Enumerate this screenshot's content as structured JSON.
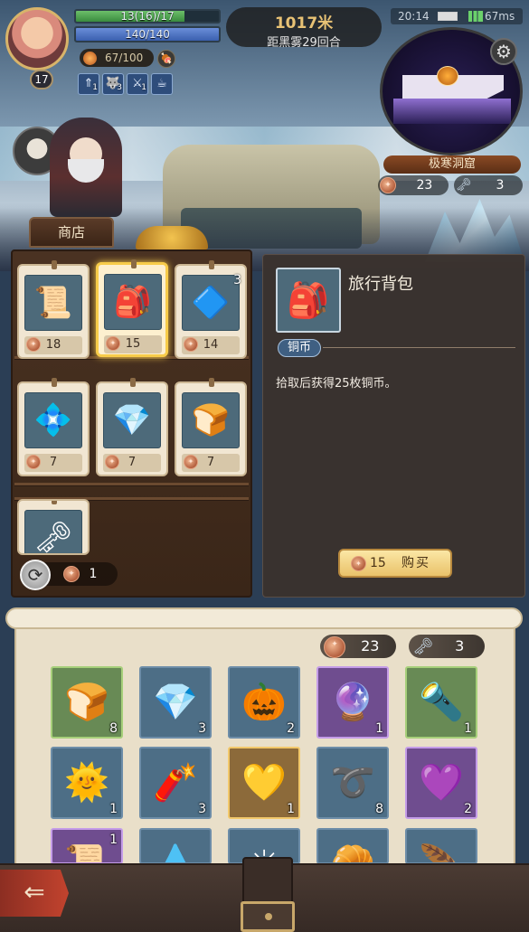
{
  "hud": {
    "hp_text": "13(16)/17",
    "hp_fraction": 0.76,
    "mp_text": "140/140",
    "mp_fraction": 1.0,
    "food_text": "67/100",
    "level": "17",
    "buffs": [
      {
        "icon": "attack-up-icon",
        "count": "1"
      },
      {
        "icon": "wolf-icon",
        "count": "3"
      },
      {
        "icon": "sword-icon",
        "count": "1"
      },
      {
        "icon": "potion-icon",
        "count": ""
      }
    ]
  },
  "depth": {
    "distance": "1017米",
    "subtitle": "距黑雾29回合"
  },
  "status": {
    "time": "20:14",
    "ping": "67ms"
  },
  "region": {
    "name": "极寒洞窟",
    "coins": "23",
    "keys": "3"
  },
  "shop": {
    "tab_label": "商店",
    "refresh_cost": "1",
    "items": [
      {
        "icon": "scroll-icon",
        "glyph": "📜",
        "price": "18",
        "qty": "",
        "selected": false
      },
      {
        "icon": "backpack-icon",
        "glyph": "🎒",
        "price": "15",
        "qty": "",
        "selected": true
      },
      {
        "icon": "magic-scroll-icon",
        "glyph": "🔷",
        "price": "14",
        "qty": "3",
        "selected": false
      },
      {
        "icon": "crystal-shard-icon",
        "glyph": "💠",
        "price": "7",
        "qty": "",
        "selected": false
      },
      {
        "icon": "blue-crystal-icon",
        "glyph": "💎",
        "price": "7",
        "qty": "",
        "selected": false
      },
      {
        "icon": "bread-icon",
        "glyph": "🍞",
        "price": "7",
        "qty": "",
        "selected": false
      },
      {
        "icon": "key-icon",
        "glyph": "🗝",
        "price": "",
        "qty": "",
        "selected": false
      }
    ]
  },
  "detail": {
    "name": "旅行背包",
    "glyph": "🎒",
    "tag": "铜币",
    "description": "拾取后获得25枚铜币。",
    "buy_price": "15",
    "buy_label": "购买"
  },
  "inventory": {
    "coins": "23",
    "keys": "3",
    "slots": [
      {
        "icon": "bread-icon",
        "glyph": "🍞",
        "count": "8",
        "rarity": "green"
      },
      {
        "icon": "blue-crystal-icon",
        "glyph": "💎",
        "count": "3",
        "rarity": "blue"
      },
      {
        "icon": "pumpkin-spirit-icon",
        "glyph": "🎃",
        "count": "2",
        "rarity": "blue"
      },
      {
        "icon": "purple-crystal-icon",
        "glyph": "🔮",
        "count": "1",
        "rarity": "purple"
      },
      {
        "icon": "torch-icon",
        "glyph": "🔦",
        "count": "1",
        "rarity": "green"
      },
      {
        "icon": "fire-orb-icon",
        "glyph": "🌞",
        "count": "1",
        "rarity": "blue"
      },
      {
        "icon": "dynamite-icon",
        "glyph": "🧨",
        "count": "3",
        "rarity": "blue"
      },
      {
        "icon": "gold-crystal-icon",
        "glyph": "💛",
        "count": "1",
        "rarity": "gold"
      },
      {
        "icon": "rope-icon",
        "glyph": "➰",
        "count": "8",
        "rarity": "blue"
      },
      {
        "icon": "dark-crystal-icon",
        "glyph": "💜",
        "count": "2",
        "rarity": "purple"
      },
      {
        "icon": "scroll-icon",
        "glyph": "📜",
        "count": "1",
        "rarity": "purple"
      },
      {
        "icon": "water-orb-icon",
        "glyph": "💧",
        "count": "",
        "rarity": "blue"
      },
      {
        "icon": "sun-icon",
        "glyph": "☀",
        "count": "",
        "rarity": "blue"
      },
      {
        "icon": "bread-roll-icon",
        "glyph": "🥐",
        "count": "",
        "rarity": "blue"
      },
      {
        "icon": "feather-icon",
        "glyph": "🪶",
        "count": "",
        "rarity": "blue"
      }
    ]
  },
  "colors": {
    "accent_gold": "#f7cc4a",
    "hp_green": "#4fa84f",
    "mp_blue": "#4c74c4"
  }
}
